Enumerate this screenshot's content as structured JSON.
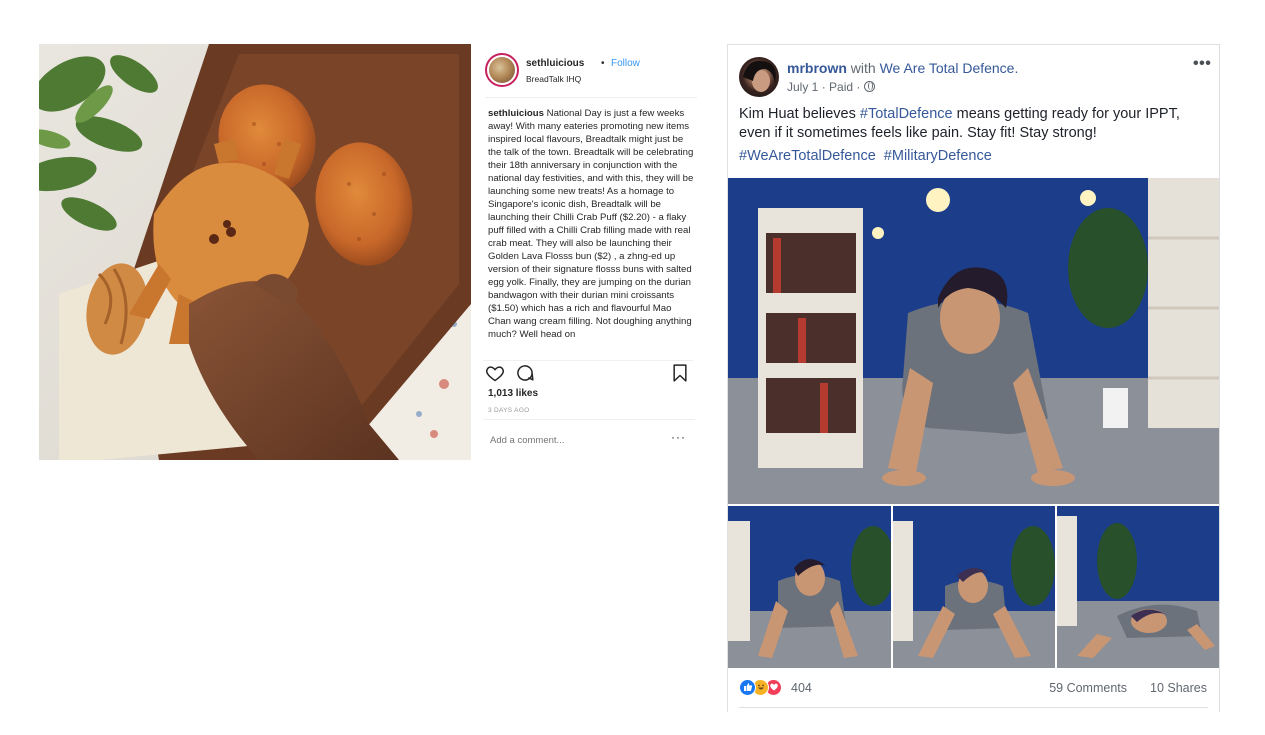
{
  "instagram": {
    "username": "sethluicious",
    "separator": "•",
    "follow_label": "Follow",
    "location": "BreadTalk IHQ",
    "caption_user": "sethluicious",
    "caption_text": "National Day is just a few weeks away! With many eateries promoting new items inspired local flavours, Breadtalk might just be the talk of the town. Breadtalk will be celebrating their 18th anniversary in conjunction with the national day festivities, and with this, they will be launching some new treats! As a homage to Singapore's iconic dish, Breadtalk will be launching their Chilli Crab Puff ($2.20) - a flaky puff filled with a Chilli Crab filling made with real crab meat. They will also be launching their Golden Lava Flosss bun ($2) , a zhng-ed up version of their signature flosss buns with salted egg yolk. Finally, they are jumping on the durian bandwagon with their durian mini croissants ($1.50) which has a rich and flavourful Mao Chan wang cream filling. Not doughing anything much? Well head on",
    "likes": "1,013 likes",
    "time": "3 DAYS AGO",
    "comment_placeholder": "Add a comment...",
    "more_icon": "more-options-icon",
    "icons": [
      "heart-icon",
      "comment-icon",
      "bookmark-icon"
    ]
  },
  "facebook": {
    "author": "mrbrown",
    "with_text": "with",
    "page_name": "We Are Total Defence.",
    "date": "July 1",
    "meta_sep": "·",
    "paid": "Paid",
    "privacy_icon": "globe-icon",
    "menu": "•••",
    "post_text_before": "Kim Huat believes ",
    "post_hashtag_inline": "#TotalDefence",
    "post_text_after": " means getting ready for your IPPT, even if it sometimes feels like pain. Stay fit! Stay strong!",
    "hashtags": [
      "#WeAreTotalDefence",
      "#MilitaryDefence"
    ],
    "reaction_icons": [
      "like-icon",
      "haha-icon",
      "love-icon"
    ],
    "reaction_count": "404",
    "comments": "59 Comments",
    "shares": "10 Shares",
    "colors": {
      "link": "#365899",
      "meta": "#616770",
      "like": "#1877f2",
      "haha": "#f7b125",
      "love": "#f33e58"
    }
  }
}
